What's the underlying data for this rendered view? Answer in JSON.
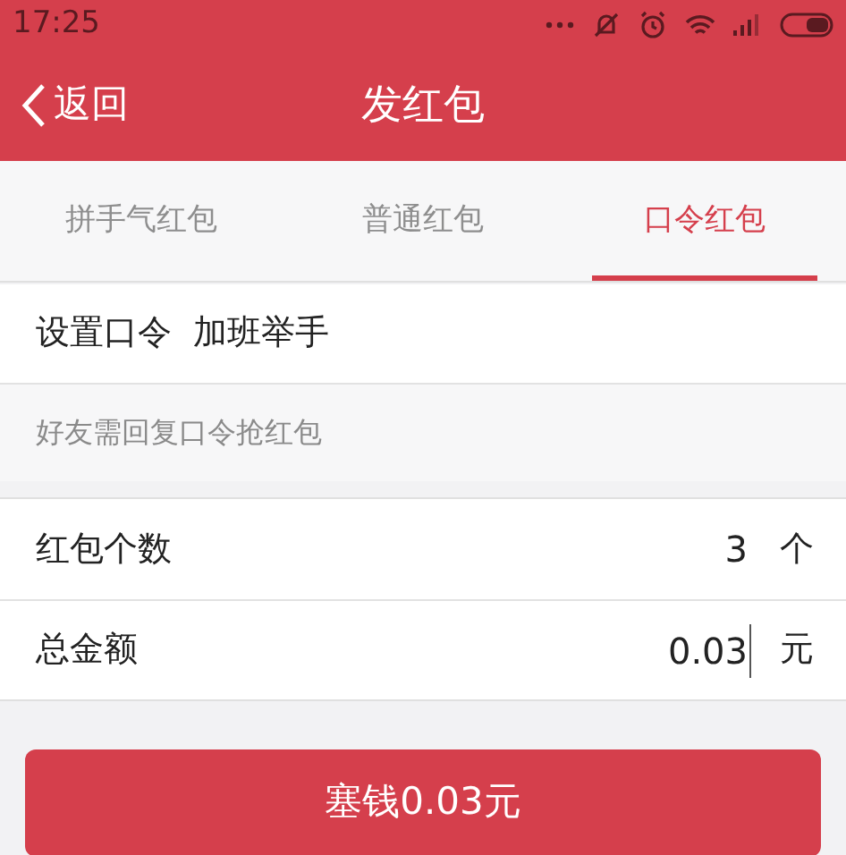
{
  "status_bar": {
    "time": "17:25"
  },
  "header": {
    "back": "返回",
    "title": "发红包"
  },
  "tabs": [
    {
      "label": "拼手气红包",
      "selected": false
    },
    {
      "label": "普通红包",
      "selected": false
    },
    {
      "label": "口令红包",
      "selected": true
    }
  ],
  "password": {
    "label": "设置口令",
    "value": "加班举手"
  },
  "hint": "好友需回复口令抢红包",
  "fields": [
    {
      "label": "红包个数",
      "value": "3",
      "unit": "个",
      "focused": false
    },
    {
      "label": "总金额",
      "value": "0.03",
      "unit": "元",
      "focused": true
    }
  ],
  "submit": "塞钱0.03元"
}
